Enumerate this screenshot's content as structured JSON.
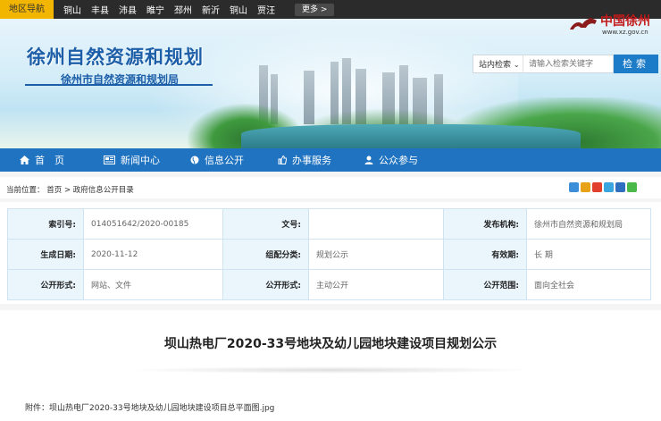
{
  "region_nav": {
    "label": "地区导航",
    "items": [
      "铜山",
      "丰县",
      "沛县",
      "睢宁",
      "邳州",
      "新沂",
      "铜山",
      "贾汪"
    ],
    "more_label": "更多 >"
  },
  "banner": {
    "title": "徐州自然资源和规划",
    "subtitle": "徐州市自然资源和规划局",
    "logo_text": "中国徐州",
    "logo_url": "www.xz.gov.cn"
  },
  "search": {
    "scope_label": "站内检索",
    "placeholder": "请输入检索关键字",
    "button_label": "检索"
  },
  "main_nav": {
    "items": [
      {
        "label": "首　页",
        "icon": "home-icon"
      },
      {
        "label": "新闻中心",
        "icon": "news-icon"
      },
      {
        "label": "信息公开",
        "icon": "globe-icon"
      },
      {
        "label": "办事服务",
        "icon": "thumbs-up-icon"
      },
      {
        "label": "公众参与",
        "icon": "user-icon"
      }
    ]
  },
  "breadcrumb": {
    "prefix": "当前位置：",
    "home": "首页",
    "separator": ">",
    "current": "政府信息公开目录"
  },
  "info": {
    "index_no_label": "索引号:",
    "index_no": "014051642/2020-00185",
    "doc_no_label": "文号:",
    "doc_no": "",
    "publisher_label": "发布机构:",
    "publisher": "徐州市自然资源和规划局",
    "date_label": "生成日期:",
    "date": "2020-11-12",
    "category_label": "组配分类:",
    "category": "规划公示",
    "validity_label": "有效期:",
    "validity": "长 期",
    "form_label": "公开形式:",
    "form": "网站、文件",
    "mode_label": "公开形式:",
    "mode": "主动公开",
    "scope_label": "公开范围:",
    "scope": "面向全社会"
  },
  "article": {
    "title": "坝山热电厂2020-33号地块及幼儿园地块建设项目规划公示",
    "attachment": "附件：坝山热电厂2020-33号地块及幼儿园地块建设项目总平面图.jpg"
  },
  "colors": {
    "nav_blue": "#1f73c0",
    "brand_blue": "#1c5ea8",
    "region_yellow": "#f2b600"
  }
}
